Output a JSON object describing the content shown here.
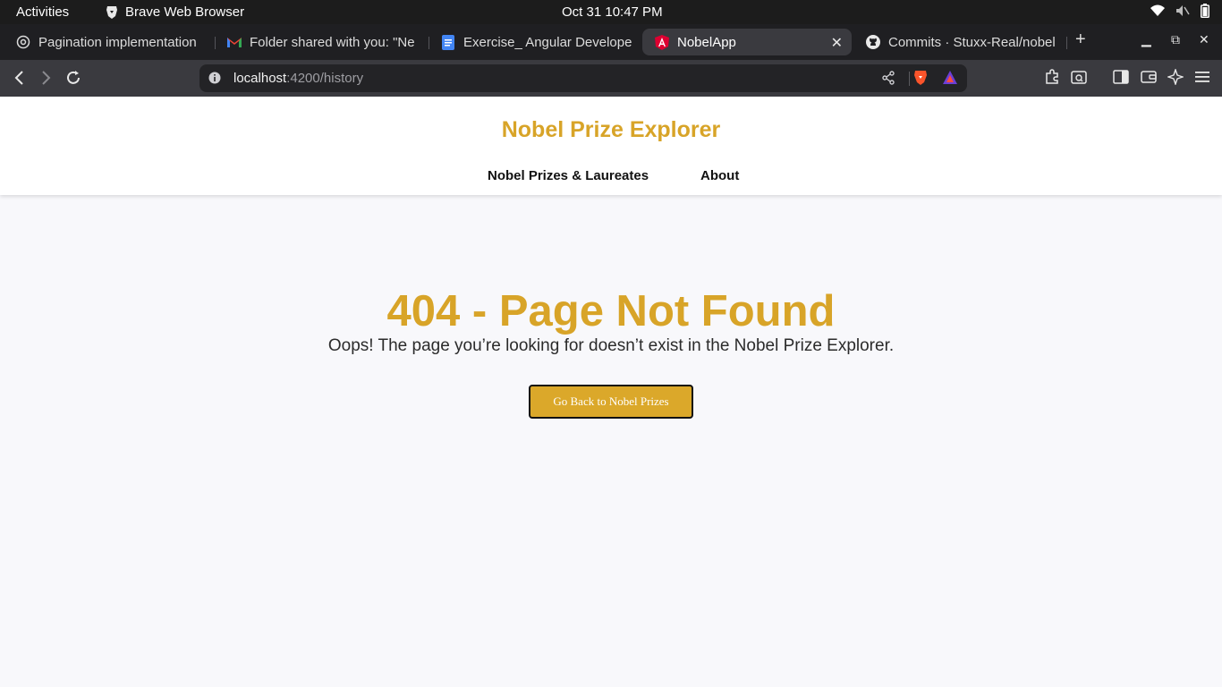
{
  "system_bar": {
    "activities": "Activities",
    "app_name": "Brave Web Browser",
    "clock": "Oct 31  10:47 PM"
  },
  "tabs": [
    {
      "title": "Pagination implementation",
      "icon": "openai-icon"
    },
    {
      "title": "Folder shared with you: \"Ne",
      "icon": "gmail-icon"
    },
    {
      "title": "Exercise_ Angular Develope",
      "icon": "google-docs-icon"
    },
    {
      "title": "NobelApp",
      "icon": "angular-icon",
      "active": true
    },
    {
      "title": "Commits · Stuxx-Real/nobel",
      "icon": "github-icon"
    }
  ],
  "address_bar": {
    "host": "localhost",
    "path": ":4200/history"
  },
  "app": {
    "title": "Nobel Prize Explorer",
    "nav": {
      "prizes": "Nobel Prizes & Laureates",
      "about": "About"
    },
    "error": {
      "title": "404 - Page Not Found",
      "message": "Oops! The page you’re looking for doesn’t exist in the Nobel Prize Explorer.",
      "button": "Go Back to Nobel Prizes"
    }
  },
  "colors": {
    "accent": "#d8a428",
    "button_bg": "#dba82a",
    "page_bg": "#f8f8fb",
    "chrome_dark": "#1f1f22",
    "chrome_mid": "#3a3a3f"
  }
}
